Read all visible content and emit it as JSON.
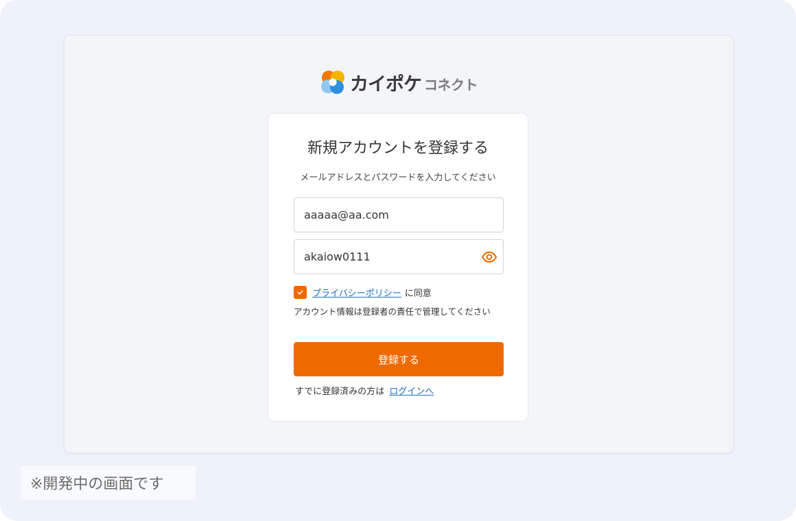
{
  "brand": {
    "name_main": "カイポケ",
    "name_sub": "コネクト",
    "colors": {
      "orange": "#f07800",
      "yellow": "#f6b400",
      "blue": "#2e8fe0",
      "light_blue": "#8fc7f2"
    }
  },
  "card": {
    "title": "新規アカウントを登録する",
    "subtitle": "メールアドレスとパスワードを入力してください"
  },
  "form": {
    "email_value": "aaaaa@aa.com",
    "password_value": "akaiow0111",
    "password_toggle_icon": "eye-icon",
    "agree_checked": true,
    "privacy_link": "プライバシーポリシー",
    "agree_suffix": "に同意",
    "note": "アカウント情報は登録者の責任で管理してください",
    "submit_label": "登録する",
    "login_prompt": "すでに登録済みの方は",
    "login_link": "ログインへ"
  },
  "footer": {
    "dev_notice": "※開発中の画面です"
  },
  "colors": {
    "accent": "#ee6a00",
    "link": "#1a6fc2",
    "background": "#eef2f9"
  }
}
